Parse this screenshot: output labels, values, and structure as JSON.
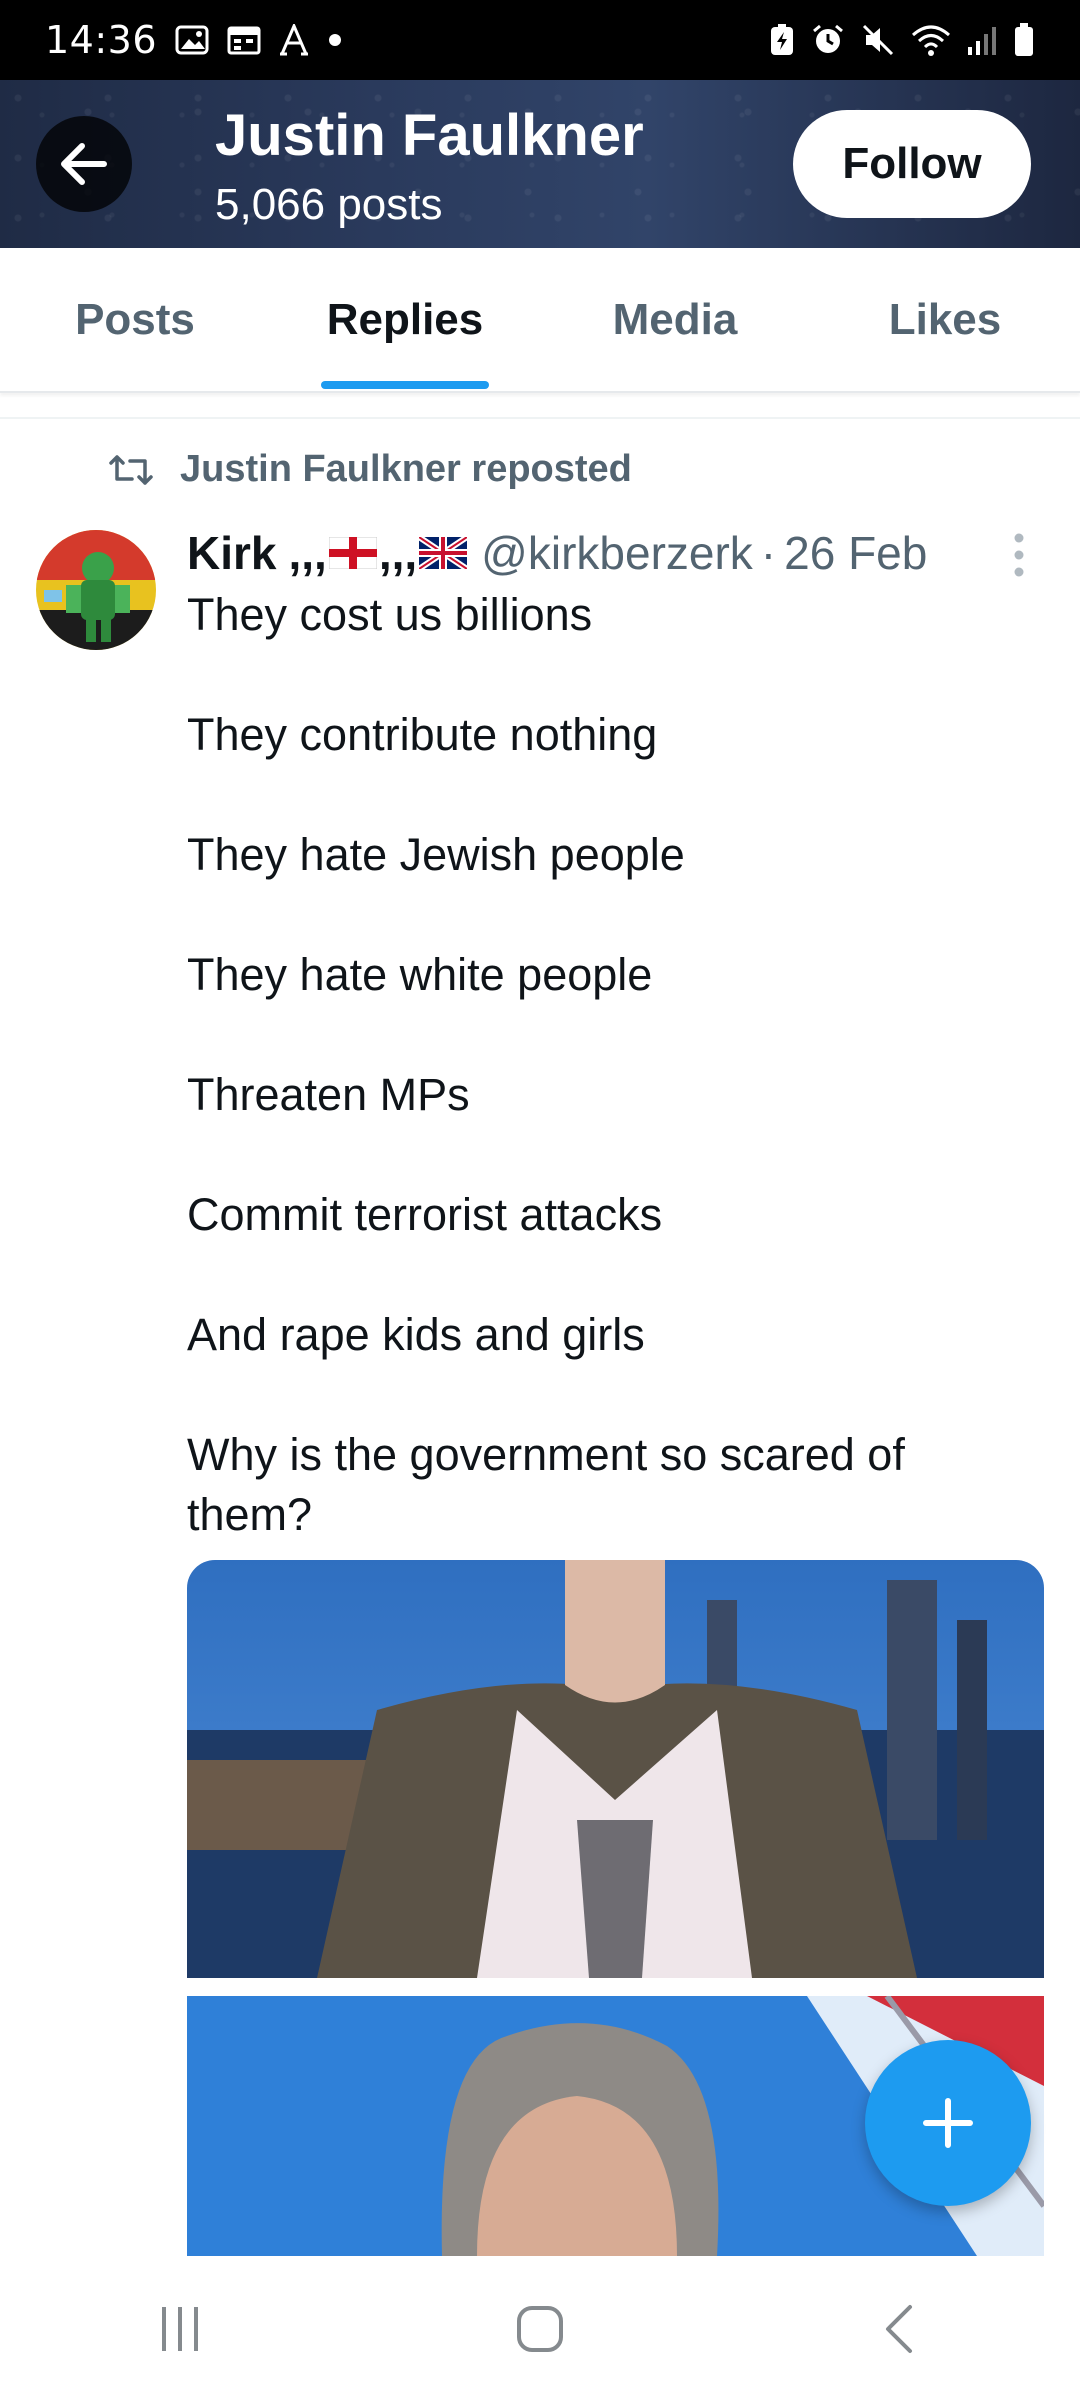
{
  "status_bar": {
    "time": "14:36",
    "left_icons": [
      "gallery-icon",
      "calendar-icon",
      "font-a-icon",
      "dot-icon"
    ],
    "right_icons": [
      "battery-saver-icon",
      "alarm-icon",
      "mute-icon",
      "wifi-icon",
      "signal-icon",
      "battery-icon"
    ]
  },
  "header": {
    "title": "Justin Faulkner",
    "subtitle": "5,066 posts",
    "follow_label": "Follow"
  },
  "tabs": [
    {
      "label": "Posts",
      "active": false
    },
    {
      "label": "Replies",
      "active": true
    },
    {
      "label": "Media",
      "active": false
    },
    {
      "label": "Likes",
      "active": false
    }
  ],
  "post": {
    "repost_label": "Justin Faulkner reposted",
    "author_name": "Kirk",
    "author_sep": ",,,",
    "handle": "@kirkberzerk",
    "separator": "·",
    "date": "26 Feb",
    "lines": [
      "They cost us billions",
      "They contribute nothing",
      "They hate Jewish people",
      "They hate white people",
      "Threaten MPs",
      "Commit terrorist attacks",
      "And rape kids and girls",
      "Why is the government so scared of them?"
    ]
  },
  "colors": {
    "accent": "#1d9bf0",
    "text_primary": "#0f1419",
    "text_secondary": "#536471"
  },
  "nav_bar": [
    "recent-apps-icon",
    "home-icon",
    "back-nav-icon"
  ]
}
